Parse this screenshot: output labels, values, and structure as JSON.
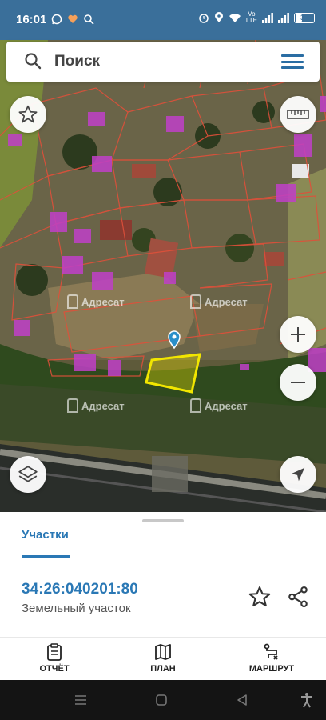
{
  "status_bar": {
    "time": "16:01",
    "volte": "Vo\nLTE",
    "battery": "37",
    "battery_level": 0.37
  },
  "search": {
    "placeholder": "Поиск"
  },
  "map": {
    "watermarks": [
      "Адресат",
      "Адресат",
      "Адресат",
      "Адресат"
    ]
  },
  "sheet": {
    "tab_label": "Участки",
    "parcel_id": "34:26:040201:80",
    "parcel_type": "Земельный участок"
  },
  "bottom_nav": {
    "report": "ОТЧЁТ",
    "plan": "ПЛАН",
    "route": "МАРШРУТ"
  },
  "colors": {
    "status_bar": "#3a6f9a",
    "accent": "#2a78b5",
    "parcel_highlight": "#f2e600",
    "building_overlay": "#c040c8",
    "boundary_lines": "#e0503a"
  }
}
